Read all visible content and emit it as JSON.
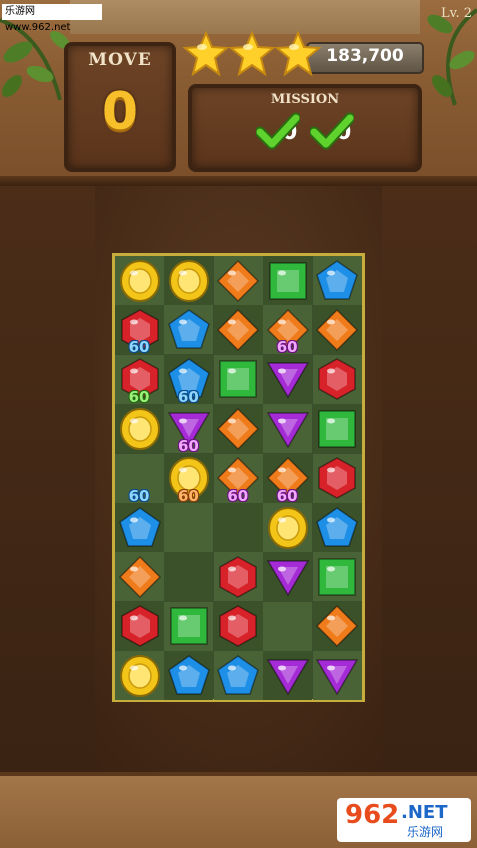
{
  "watermark": {
    "top_text": "乐游网 www.962.net",
    "bottom_number": "962",
    "bottom_suffix": ".NET",
    "bottom_cn": "乐游网"
  },
  "header": {
    "level_label": "Lv. 2",
    "move_label": "MOVE",
    "move_count": "0",
    "score": "183,700",
    "stars_earned": 3,
    "stars_total": 3,
    "mission_label": "MISSION",
    "missions": [
      {
        "target": "0",
        "status": "complete"
      },
      {
        "target": "0",
        "status": "complete"
      }
    ]
  },
  "colors": {
    "red": "#d8222a",
    "blue": "#1e8fe6",
    "orange": "#f07b1a",
    "green": "#2fb83b",
    "yellow": "#f2c518",
    "purple": "#a52bd6",
    "board_light": "#4a6336",
    "board_dark": "#3b5129",
    "frame": "#c7ad3c"
  },
  "board": {
    "cols": 5,
    "rows": 9,
    "grid": [
      [
        "yellow",
        "yellow",
        "orange",
        "green",
        "blue"
      ],
      [
        "red",
        "blue",
        "orange",
        "orange",
        "orange"
      ],
      [
        "red",
        "blue",
        "green",
        "purple",
        "red"
      ],
      [
        "yellow",
        "purple",
        "orange",
        "purple",
        "green"
      ],
      [
        "",
        "yellow",
        "orange",
        "orange",
        "red"
      ],
      [
        "blue",
        "",
        "",
        "yellow",
        "blue"
      ],
      [
        "orange",
        "",
        "red",
        "purple",
        "green"
      ],
      [
        "red",
        "green",
        "red",
        "",
        "orange"
      ],
      [
        "yellow",
        "blue",
        "blue",
        "purple",
        "purple"
      ]
    ],
    "bonuses": [
      {
        "text": "60",
        "row": 1,
        "col": 0,
        "color": "blue"
      },
      {
        "text": "60",
        "row": 1,
        "col": 3,
        "color": "purple"
      },
      {
        "text": "60",
        "row": 2,
        "col": 0,
        "color": "green"
      },
      {
        "text": "60",
        "row": 2,
        "col": 1,
        "color": "blue"
      },
      {
        "text": "60",
        "row": 3,
        "col": 1,
        "color": "purple"
      },
      {
        "text": "60",
        "row": 4,
        "col": 0,
        "color": "blue"
      },
      {
        "text": "60",
        "row": 4,
        "col": 1,
        "color": "orange"
      },
      {
        "text": "60",
        "row": 4,
        "col": 2,
        "color": "purple"
      },
      {
        "text": "60",
        "row": 4,
        "col": 3,
        "color": "purple"
      }
    ]
  }
}
